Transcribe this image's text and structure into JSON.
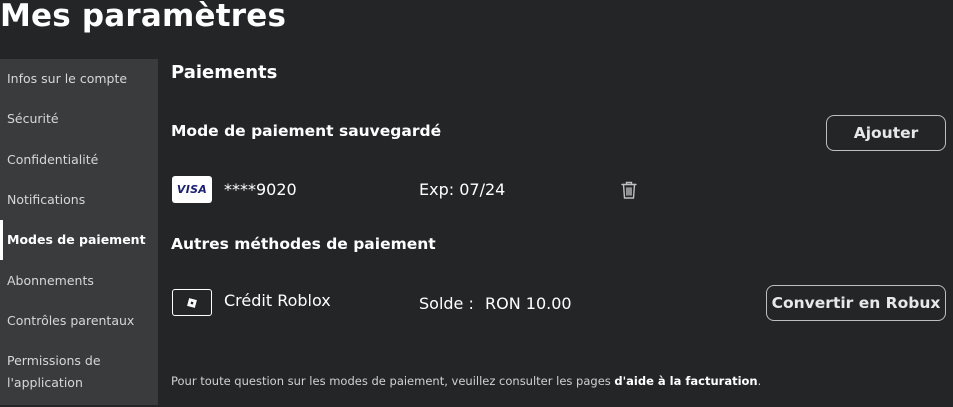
{
  "page": {
    "title": "Mes paramètres"
  },
  "sidebar": {
    "items": [
      {
        "label": "Infos sur le compte"
      },
      {
        "label": "Sécurité"
      },
      {
        "label": "Confidentialité"
      },
      {
        "label": "Notifications"
      },
      {
        "label": "Modes de paiement",
        "active": true
      },
      {
        "label": "Abonnements"
      },
      {
        "label": "Contrôles parentaux"
      },
      {
        "label_line1": "Permissions de",
        "label_line2": "l'application"
      }
    ]
  },
  "main": {
    "section_title": "Paiements",
    "saved": {
      "heading": "Mode de paiement sauvegardé",
      "add_button": "Ajouter",
      "card": {
        "brand": "VISA",
        "number": "****9020",
        "expiry": "Exp: 07/24",
        "delete_icon": "trash-icon"
      }
    },
    "other": {
      "heading": "Autres méthodes de paiement",
      "credit": {
        "name": "Crédit Roblox",
        "balance_label": "Solde :",
        "balance_value": "RON 10.00",
        "convert_button": "Convertir en Robux",
        "icon": "roblox-icon"
      }
    },
    "footer": {
      "text": "Pour toute question sur les modes de paiement, veuillez consulter les pages ",
      "link": "d'aide à la facturation",
      "suffix": "."
    }
  },
  "colors": {
    "background": "#232527",
    "sidebar": "#393b3d",
    "text": "#ffffff",
    "visa_blue": "#1a1f71"
  }
}
